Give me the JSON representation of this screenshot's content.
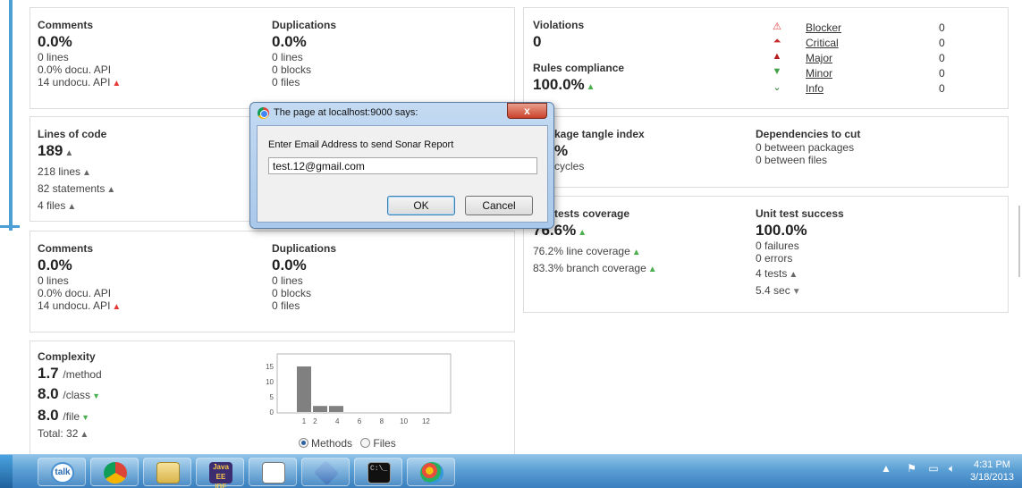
{
  "panels": {
    "comments_top": {
      "comments": {
        "title": "Comments",
        "value": "0.0%",
        "lines": [
          "0 lines",
          "0.0% docu. API",
          "14 undocu. API"
        ]
      },
      "duplications": {
        "title": "Duplications",
        "value": "0.0%",
        "lines": [
          "0 lines",
          "0 blocks",
          "0 files"
        ]
      }
    },
    "violations": {
      "title": "Violations",
      "value": "0",
      "rules_title": "Rules compliance",
      "rules_value": "100.0%",
      "severities": [
        {
          "name": "Blocker",
          "count": "0",
          "icon": "blocker-icon",
          "color": "#e53935"
        },
        {
          "name": "Critical",
          "count": "0",
          "icon": "critical-icon",
          "color": "#c62828"
        },
        {
          "name": "Major",
          "count": "0",
          "icon": "major-icon",
          "color": "#b71c1c"
        },
        {
          "name": "Minor",
          "count": "0",
          "icon": "minor-icon",
          "color": "#43a047"
        },
        {
          "name": "Info",
          "count": "0",
          "icon": "info-icon",
          "color": "#2e7d32"
        }
      ]
    },
    "loc": {
      "title": "Lines of code",
      "value": "189",
      "lines": [
        "218 lines",
        "82 statements",
        "4 files"
      ]
    },
    "tangle": {
      "title_partial": "kage tangle index",
      "value_partial": "%",
      "line_partial": "cycles",
      "deps_title": "Dependencies to cut",
      "deps_lines": [
        "0 between packages",
        "0 between files"
      ]
    },
    "coverage": {
      "title_partial": "tests coverage",
      "value_partial": "76.6%",
      "lines": [
        "76.2% line coverage",
        "83.3% branch coverage"
      ],
      "success_title": "Unit test success",
      "success_value": "100.0%",
      "success_lines": [
        "0 failures",
        "0 errors",
        "4 tests",
        "5.4 sec"
      ]
    },
    "comments_bottom": {
      "comments": {
        "title": "Comments",
        "value": "0.0%",
        "lines": [
          "0 lines",
          "0.0% docu. API",
          "14 undocu. API"
        ]
      },
      "duplications": {
        "title": "Duplications",
        "value": "0.0%",
        "lines": [
          "0 lines",
          "0 blocks",
          "0 files"
        ]
      }
    },
    "complexity": {
      "title": "Complexity",
      "method_value": "1.7",
      "method_unit": "/method",
      "class_value": "8.0",
      "class_unit": "/class",
      "file_value": "8.0",
      "file_unit": "/file",
      "total": "Total: 32",
      "radio_methods": "Methods",
      "radio_files": "Files"
    }
  },
  "chart_data": {
    "type": "bar",
    "categories": [
      "1",
      "2",
      "4",
      "6",
      "8",
      "10",
      "12"
    ],
    "values": [
      15,
      2,
      2,
      0,
      0,
      0,
      0
    ],
    "y_ticks": [
      "15",
      "10",
      "5",
      "0"
    ],
    "ylim": [
      0,
      15
    ],
    "bar_color": "#808080"
  },
  "dialog": {
    "title": "The page at localhost:9000 says:",
    "close": "x",
    "message": "Enter Email Address to send Sonar Report",
    "input_value": "test.12@gmail.com",
    "ok": "OK",
    "cancel": "Cancel"
  },
  "taskbar": {
    "apps": [
      "talk-icon",
      "chrome-icon",
      "folder-icon",
      "java-ee-ide-icon",
      "chart-app-icon",
      "virtualbox-icon",
      "cmd-icon",
      "paint-icon"
    ],
    "talk_label": "talk",
    "javaee_label": "Java EE IDE",
    "cmd_label": "C:\\_",
    "time": "4:31 PM",
    "date": "3/18/2013"
  }
}
